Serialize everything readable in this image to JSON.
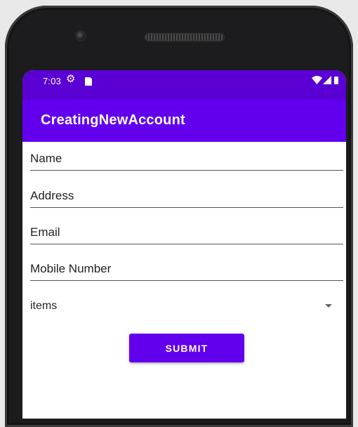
{
  "status_bar": {
    "time": "7:03",
    "settings_icon": "gear-icon",
    "sd_icon": "sd-card-icon",
    "wifi_icon": "wifi-icon",
    "signal_icon": "signal-icon",
    "battery_icon": "battery-icon"
  },
  "app_bar": {
    "title": "CreatingNewAccount"
  },
  "form": {
    "fields": [
      {
        "label": "Name"
      },
      {
        "label": "Address"
      },
      {
        "label": "Email"
      },
      {
        "label": "Mobile Number"
      }
    ],
    "spinner": {
      "selected": "items"
    },
    "submit_label": "SUBMIT"
  },
  "colors": {
    "status_bar": "#5b00d4",
    "primary": "#6200ee",
    "background": "#ffffff"
  }
}
